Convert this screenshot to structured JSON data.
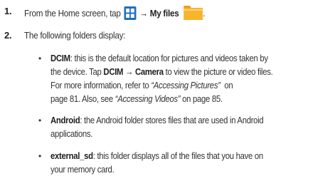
{
  "steps": [
    {
      "number": "1.",
      "prefix": "From the Home screen, tap",
      "apps_icon": "apps-grid-icon",
      "arrow": "→",
      "target": "My files",
      "target_icon": "folder-icon",
      "suffix": "."
    },
    {
      "number": "2.",
      "text": "The following folders display:"
    }
  ],
  "bullets": [
    {
      "name": "DCIM",
      "lines": [
        ": this is the default location for pictures and videos taken by",
        "the device. Tap",
        "to view the picture or video files.",
        "For more information, refer to",
        "on",
        "page 81. Also, see",
        "on page 85."
      ],
      "tap_target_1": "DCIM",
      "tap_arrow": "→",
      "tap_target_2": "Camera",
      "ref_1": "“Accessing Pictures”",
      "ref_2": "“Accessing Videos”"
    },
    {
      "name": "Android",
      "lines": [
        ": the Android folder stores files that are used in Android",
        "applications."
      ]
    },
    {
      "name": "external_sd",
      "lines": [
        ": this folder displays all of the files that you have on",
        "your memory card."
      ]
    }
  ],
  "colors": {
    "apps_icon": "#1e6fc1",
    "folder_body": "#f7b52c",
    "folder_tab": "#f39a1e"
  }
}
